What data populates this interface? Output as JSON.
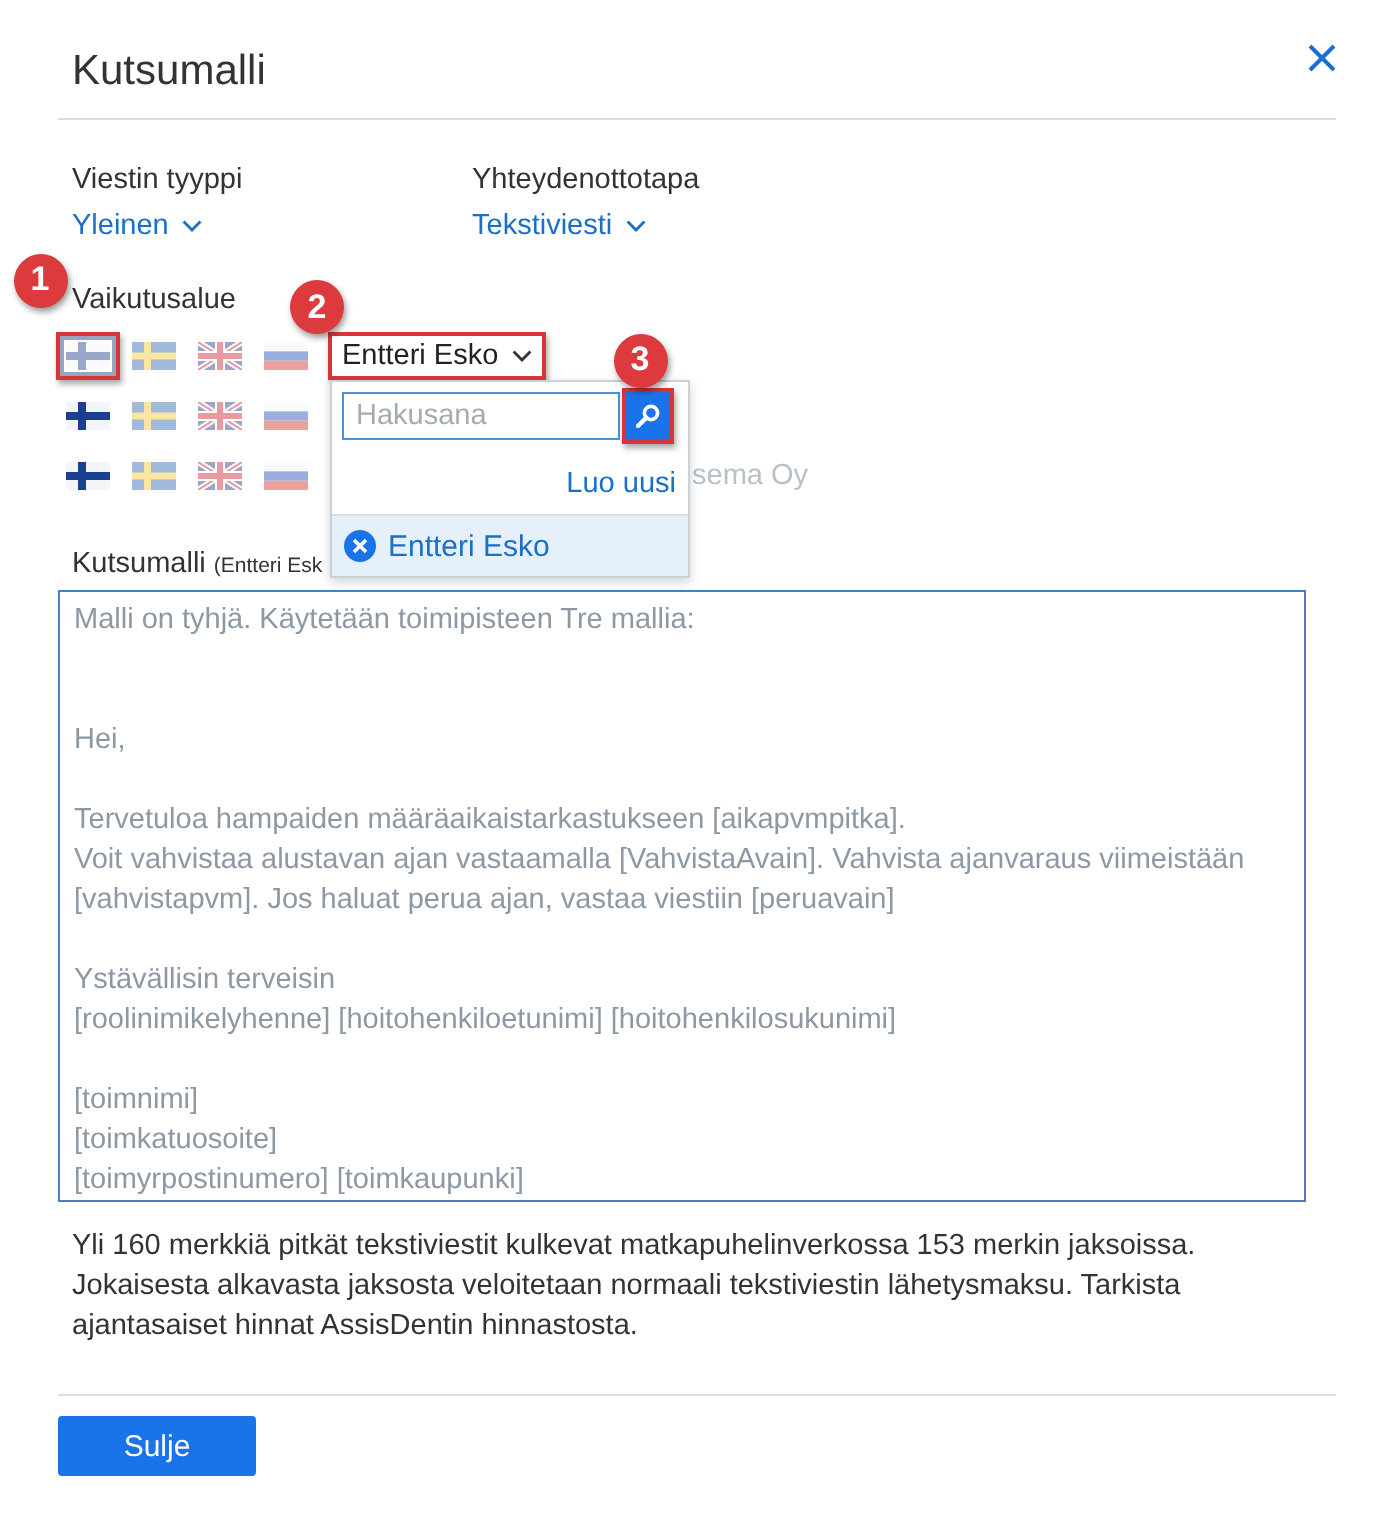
{
  "dialog": {
    "title": "Kutsumalli"
  },
  "fields": [
    {
      "label": "Viestin tyyppi",
      "value": "Yleinen"
    },
    {
      "label": "Yhteydenottotapa",
      "value": "Tekstiviesti"
    }
  ],
  "scope": {
    "label": "Vaikutusalue",
    "rows": [
      {
        "flags": [
          {
            "kind": "fi",
            "selected": true,
            "active": false,
            "callout": "1"
          },
          {
            "kind": "se",
            "selected": false,
            "active": false
          },
          {
            "kind": "gb",
            "selected": false,
            "active": false
          },
          {
            "kind": "ru",
            "selected": false,
            "active": false
          }
        ],
        "selector": {
          "value": "Entteri Esko",
          "expanded": true,
          "callout": "2",
          "picker": {
            "search_placeholder": "Hakusana",
            "search_callout": "3",
            "create_link": "Luo uusi",
            "items": [
              {
                "label": "Entteri Esko",
                "selected": true
              }
            ]
          }
        }
      },
      {
        "flags": [
          {
            "kind": "fi",
            "selected": false,
            "active": true
          },
          {
            "kind": "se",
            "selected": false,
            "active": false
          },
          {
            "kind": "gb",
            "selected": false,
            "active": false
          },
          {
            "kind": "ru",
            "selected": false,
            "active": false
          }
        ]
      },
      {
        "flags": [
          {
            "kind": "fi",
            "selected": false,
            "active": true
          },
          {
            "kind": "se",
            "selected": false,
            "active": false
          },
          {
            "kind": "gb",
            "selected": false,
            "active": false
          },
          {
            "kind": "ru",
            "selected": false,
            "active": false
          }
        ],
        "note": "sema Oy"
      }
    ]
  },
  "template": {
    "label": "Kutsumalli",
    "label_note": "(Entteri Esk",
    "placeholder": "Malli on tyhjä. Käytetään toimipisteen Tre mallia:\n\n\nHei,\n\nTervetuloa hampaiden määräaikaistarkastukseen [aikapvmpitka].\nVoit vahvistaa alustavan ajan vastaamalla [VahvistaAvain]. Vahvista ajanvaraus viimeistään [vahvistapvm]. Jos haluat perua ajan, vastaa viestiin [peruavain]\n\nYstävällisin terveisin\n[roolinimikelyhenne] [hoitohenkiloetunimi] [hoitohenkilosukunimi]\n\n[toimnimi]\n[toimkatuosoite]\n[toimyrpostinumero] [toimkaupunki]"
  },
  "info": "Yli 160 merkkiä pitkät tekstiviestit kulkevat matkapuhelinverkossa 153 merkin jaksoissa. Jokaisesta alkavasta jaksosta veloitetaan normaali tekstiviestin lähetysmaksu. Tarkista ajantasaiset hinnat AssisDentin hinnastosta.",
  "buttons": [
    "Sulje"
  ]
}
